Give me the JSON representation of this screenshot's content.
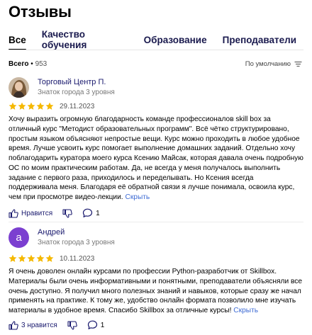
{
  "page": {
    "title": "Отзывы"
  },
  "tabs": [
    {
      "label": "Все",
      "active": true
    },
    {
      "label": "Качество обучения",
      "active": false
    },
    {
      "label": "Образование",
      "active": false
    },
    {
      "label": "Преподаватели",
      "active": false
    }
  ],
  "stats": {
    "label": "Всего",
    "count": "953"
  },
  "sort": {
    "label": "По умолчанию",
    "icon": "sort-icon"
  },
  "colors": {
    "star": "#f5b800",
    "link": "#3f6cd4",
    "avatar2": "#7b3fd0"
  },
  "reviews": [
    {
      "author": "Торговый Центр П.",
      "level": "Знаток города 3 уровня",
      "rating": 5,
      "date": "29.11.2023",
      "text": "Хочу выразить огромную благодарность команде профессионалов skill box за отличный курс \"Методист образовательных программ\". Всё чётко структурировано, простым языком объясняют непростые вещи. Курс можно проходить в любое удобное время. Лучше усвоить курс помогает выполнение домашних заданий. Отдельно хочу поблагодарить куратора моего курса Ксению Майсак, которая давала очень подробную ОС по моим практическим работам. Да, не всегда у меня получалось выполнить задание с первого раза, приходилось и переделывать. Но Ксения всегда поддерживала меня. Благодаря её обратной связи я лучше понимала, освоила курс, чем при просмотре видео-лекции.",
      "more": "Скрыть",
      "like_label": "Нравится",
      "comments": "1"
    },
    {
      "author": "Андрей",
      "avatar_letter": "а",
      "level": "Знаток города 3 уровня",
      "rating": 5,
      "date": "10.11.2023",
      "text": "Я очень доволен онлайн курсами по профессии Python-разработчик от Skillbox. Материалы были очень информативными и понятными, преподаватели объясняли все очень доступно. Я получил много полезных знаний и навыков, которые сразу же начал применять на практике. К тому же, удобство онлайн формата позволило мне изучать материалы в удобное время. Спасибо Skillbox за отличные курсы!",
      "more": "Скрыть",
      "like_label": "3 нравится",
      "comments": "1"
    }
  ]
}
